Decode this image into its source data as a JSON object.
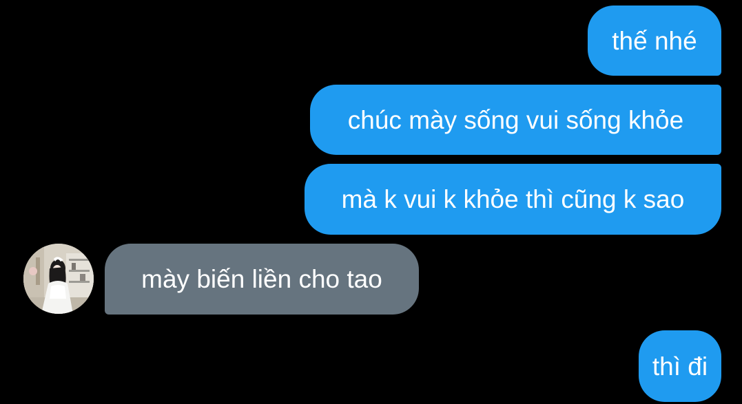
{
  "conversation": {
    "messages": [
      {
        "sender": "me",
        "text": "thế nhé"
      },
      {
        "sender": "me",
        "text": "chúc mày sống vui sống khỏe"
      },
      {
        "sender": "me",
        "text": "mà k vui k khỏe thì cũng k sao"
      },
      {
        "sender": "other",
        "text": "mày biến liền cho tao"
      },
      {
        "sender": "me",
        "text": "thì đi"
      }
    ]
  },
  "colors": {
    "background": "#000000",
    "outgoing_bubble": "#1f9bf0",
    "incoming_bubble": "#66747f",
    "text": "#ffffff"
  },
  "icons": {
    "avatar": "contact-avatar-photo"
  }
}
